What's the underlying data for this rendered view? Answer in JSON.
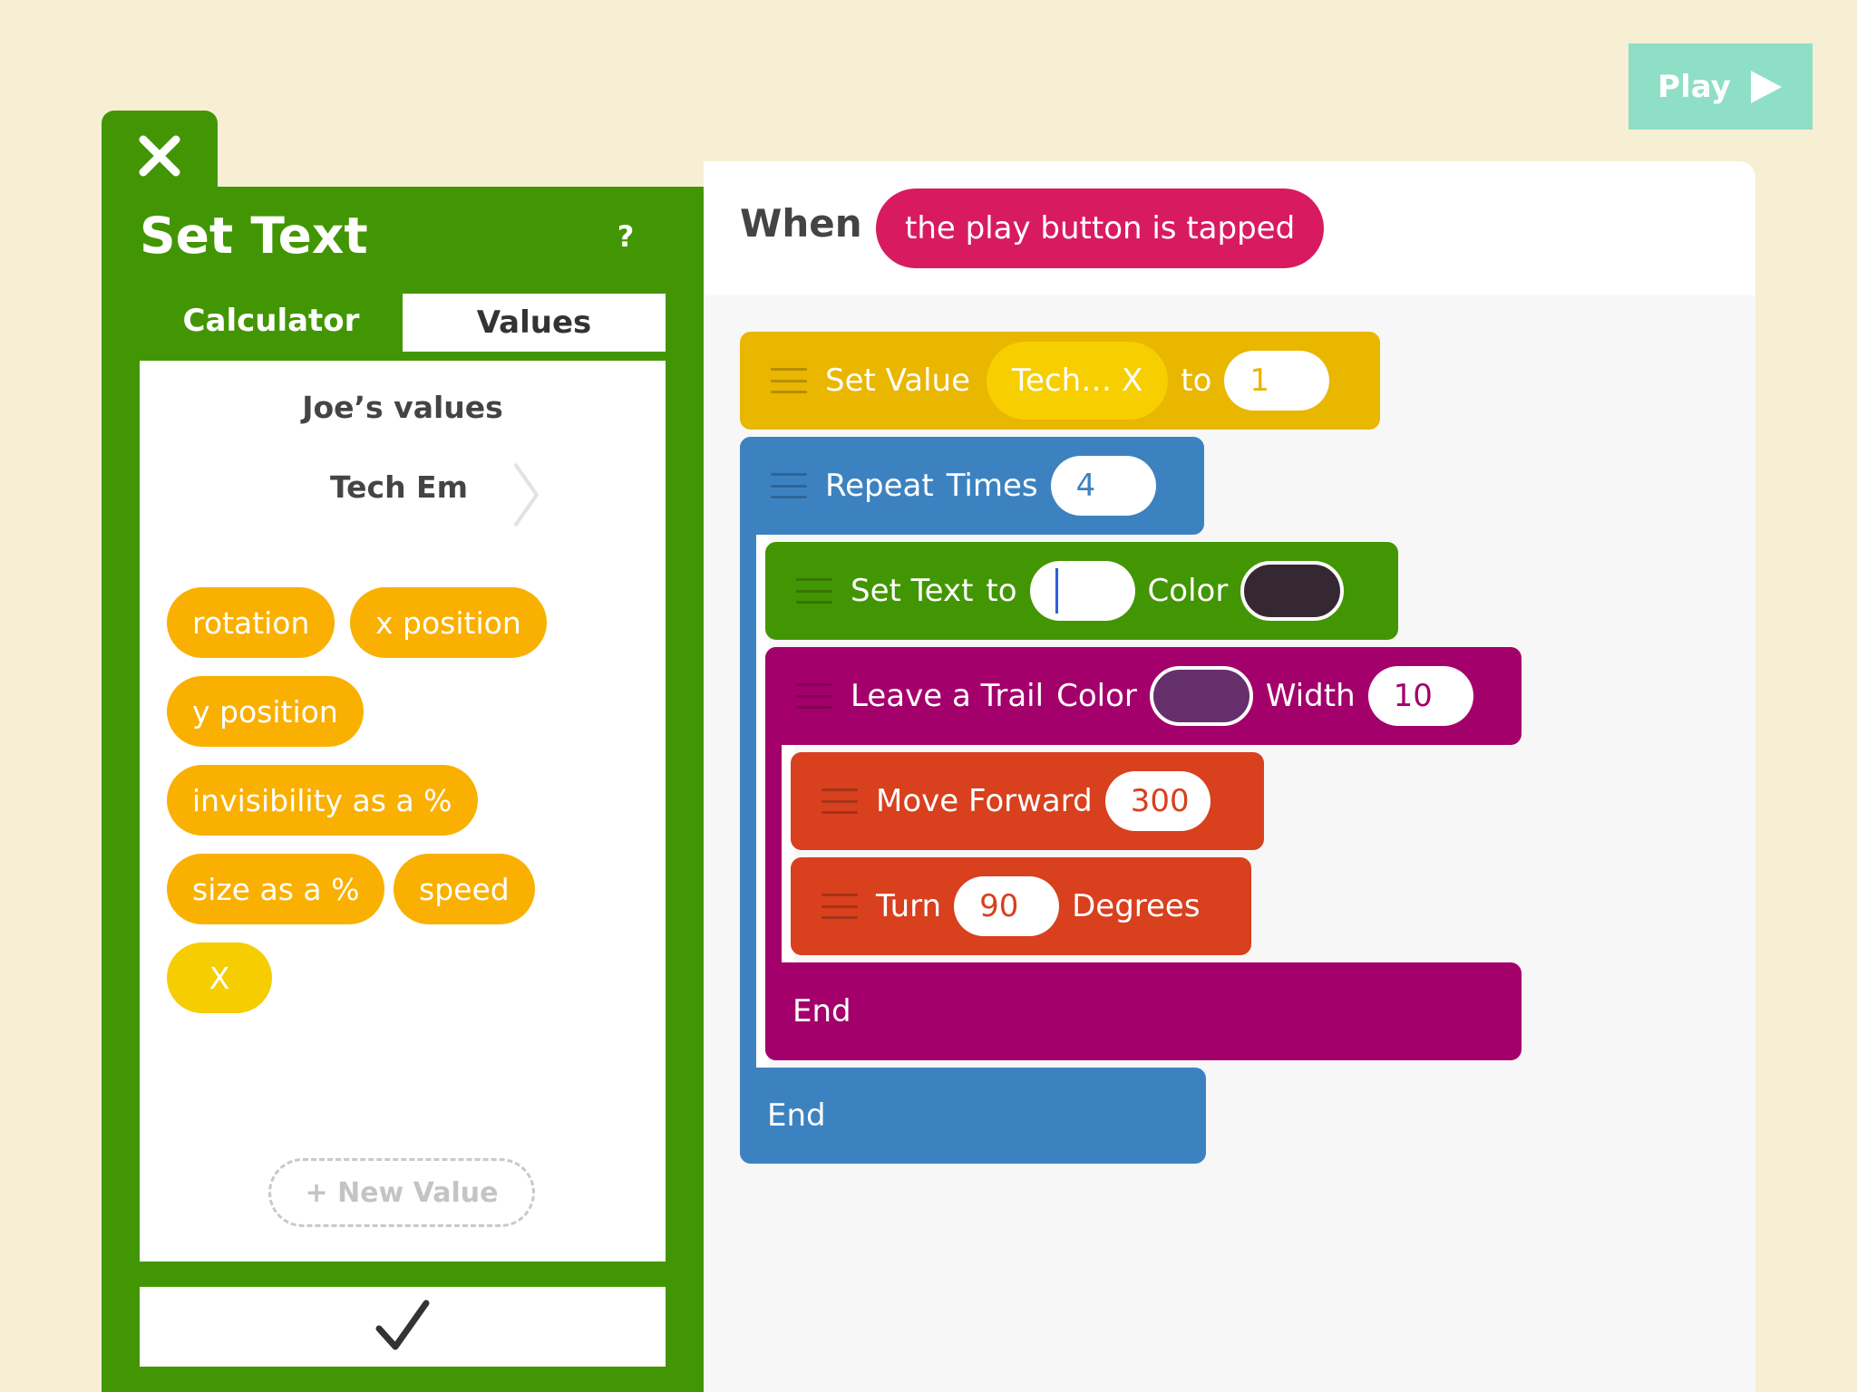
{
  "play_button": {
    "label": "Play",
    "icon": "play-triangle-icon",
    "color": "#8edfc6"
  },
  "editor_panel": {
    "title": "Set Text",
    "help_label": "?",
    "close_icon": "close-x-icon",
    "confirm_icon": "checkmark-icon",
    "color": "#439603",
    "tabs": [
      {
        "label": "Calculator",
        "selected": false
      },
      {
        "label": "Values",
        "selected": true
      }
    ],
    "owner_label": "Joe’s values",
    "object_name": "Tech Em",
    "value_chips": [
      {
        "label": "rotation"
      },
      {
        "label": "x position"
      },
      {
        "label": "y position"
      },
      {
        "label": "invisibility as a %"
      },
      {
        "label": "size as a %"
      },
      {
        "label": "speed"
      },
      {
        "label": "X"
      }
    ],
    "new_value_label": "+ New Value"
  },
  "script": {
    "when_label": "When",
    "trigger_label": "the play button is tapped",
    "trigger_color": "#d81b60",
    "blocks": {
      "set_value": {
        "label": "Set Value",
        "variable": "Tech… X",
        "to_label": "to",
        "value": "1",
        "color": "#e9b600"
      },
      "repeat": {
        "label1": "Repeat",
        "label2": "Times",
        "count": "4",
        "end_label": "End",
        "color": "#3d82c0"
      },
      "set_text": {
        "label1": "Set Text",
        "label2": "to",
        "value": "",
        "color_label": "Color",
        "color_value": "#352833",
        "color": "#439603"
      },
      "leave_trail": {
        "label1": "Leave a Trail",
        "color_label": "Color",
        "color_value": "#65306c",
        "width_label": "Width",
        "width_value": "10",
        "end_label": "End",
        "color": "#a3006b"
      },
      "move_forward": {
        "label": "Move Forward",
        "value": "300",
        "color": "#d8401e"
      },
      "turn": {
        "label": "Turn",
        "value": "90",
        "unit_label": "Degrees",
        "color": "#d8401e"
      }
    }
  }
}
